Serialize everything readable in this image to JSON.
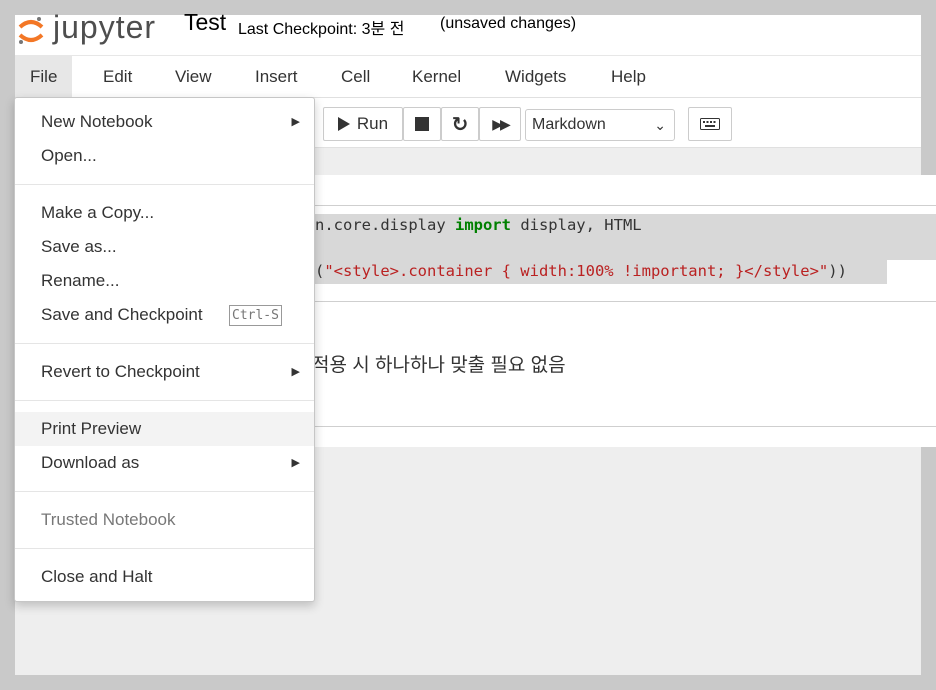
{
  "header": {
    "logo_text": "jupyter",
    "notebook_name": "Test",
    "checkpoint": "Last Checkpoint: 3분 전",
    "autosave": "(unsaved changes)"
  },
  "menubar": {
    "items": [
      "File",
      "Edit",
      "View",
      "Insert",
      "Cell",
      "Kernel",
      "Widgets",
      "Help"
    ]
  },
  "toolbar": {
    "run_label": "Run",
    "cell_type": "Markdown"
  },
  "cells": {
    "code_line1_a": "n.core.display ",
    "code_line1_kw": "import",
    "code_line1_b": " display, HTML",
    "code_line2_a": "(",
    "code_line2_str": "\"<style>.container { width:100% !important; }</style>\"",
    "code_line2_b": "))",
    "markdown_text": "적용 시 하나하나 맞출 필요 없음"
  },
  "file_menu": {
    "new_notebook": "New Notebook",
    "open": "Open...",
    "make_copy": "Make a Copy...",
    "save_as": "Save as...",
    "rename": "Rename...",
    "save_checkpoint": "Save and Checkpoint",
    "save_checkpoint_shortcut": "Ctrl-S",
    "revert": "Revert to Checkpoint",
    "print_preview": "Print Preview",
    "download_as": "Download as",
    "trusted": "Trusted Notebook",
    "close_halt": "Close and Halt"
  },
  "colors": {
    "keyword": "#008000",
    "string": "#ba2121",
    "logo_orange": "#f37726"
  }
}
